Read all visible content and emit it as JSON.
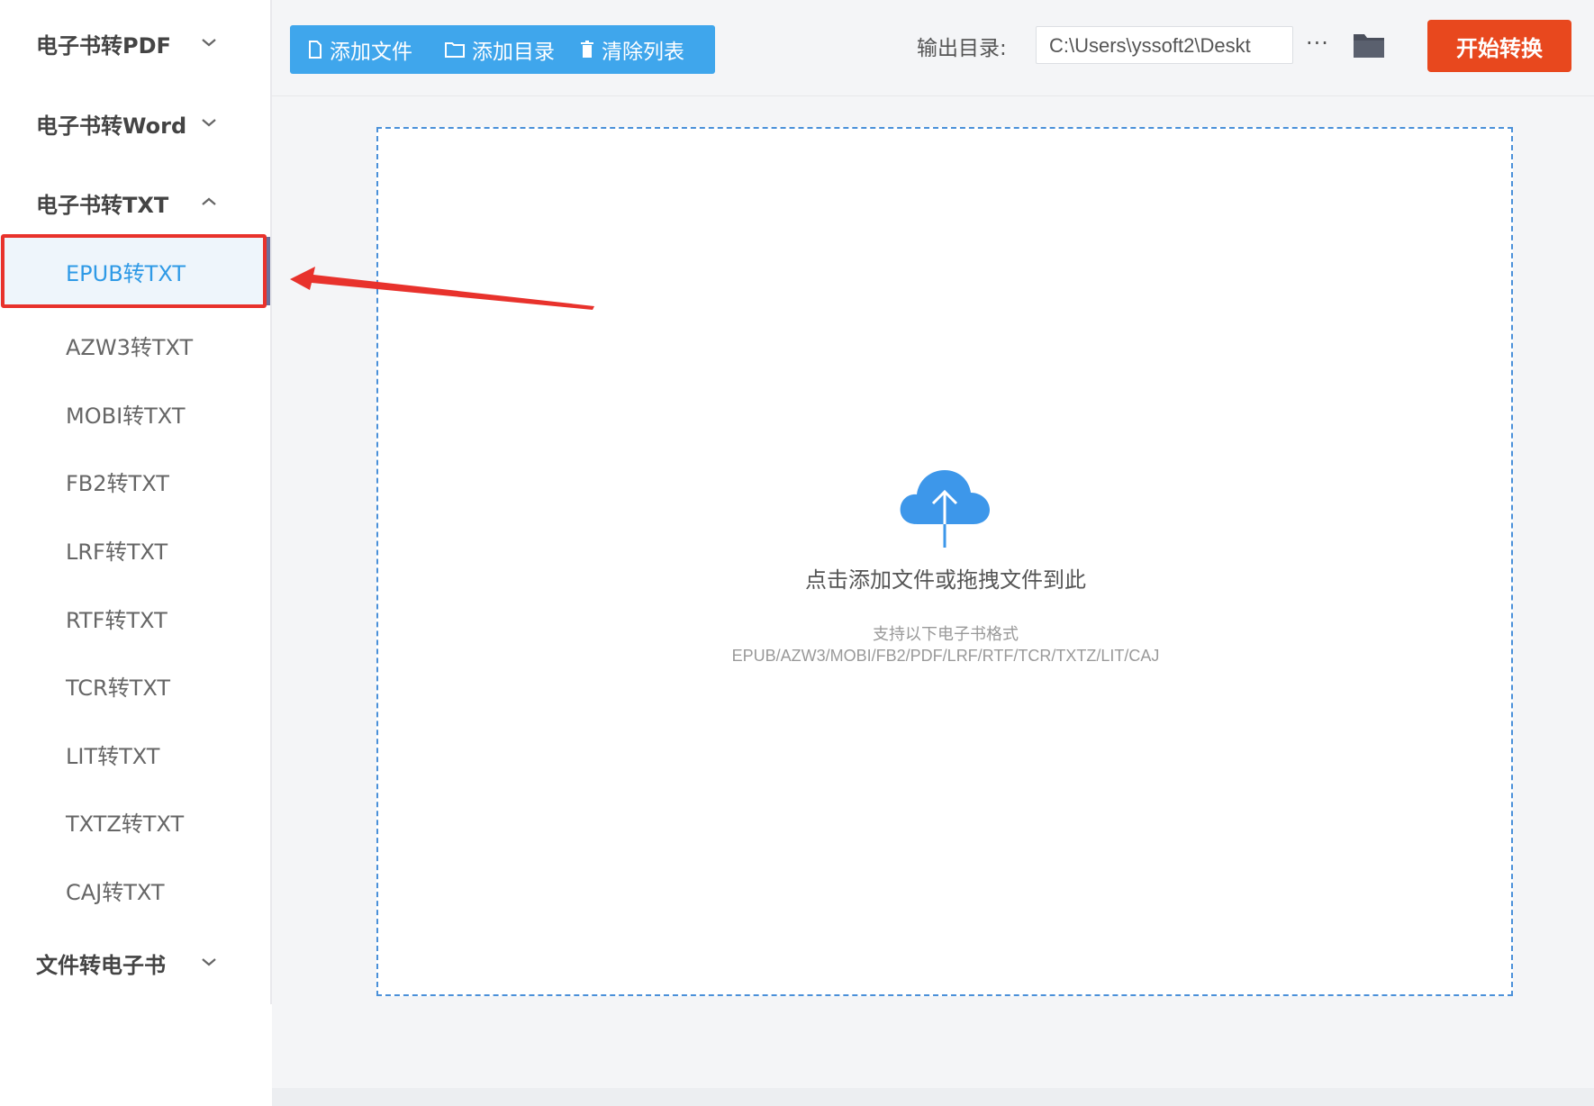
{
  "sidebar": {
    "groups": [
      {
        "label": "电子书转PDF",
        "expanded": false
      },
      {
        "label": "电子书转Word",
        "expanded": false
      },
      {
        "label": "电子书转TXT",
        "expanded": true
      },
      {
        "label": "文件转电子书",
        "expanded": false
      }
    ],
    "txt_items": [
      "EPUB转TXT",
      "AZW3转TXT",
      "MOBI转TXT",
      "FB2转TXT",
      "LRF转TXT",
      "RTF转TXT",
      "TCR转TXT",
      "LIT转TXT",
      "TXTZ转TXT",
      "CAJ转TXT"
    ],
    "active_item": "EPUB转TXT"
  },
  "toolbar": {
    "add_file": "添加文件",
    "add_dir": "添加目录",
    "clear_list": "清除列表",
    "output_label": "输出目录:",
    "output_path": "C:\\Users\\yssoft2\\Deskt",
    "more": "···",
    "start": "开始转换"
  },
  "drop_zone": {
    "main_text": "点击添加文件或拖拽文件到此",
    "sub_text": "支持以下电子书格式",
    "formats": "EPUB/AZW3/MOBI/FB2/PDF/LRF/RTF/TCR/TXTZ/LIT/CAJ"
  },
  "colors": {
    "accent_blue": "#3fa6ec",
    "start_orange": "#e8481e",
    "annotation_red": "#e8322c",
    "active_text": "#2f9ae6"
  },
  "icons": [
    "file-icon",
    "folder-outline-icon",
    "trash-icon",
    "folder-icon",
    "cloud-upload-icon",
    "chevron-down-icon",
    "chevron-up-icon"
  ]
}
